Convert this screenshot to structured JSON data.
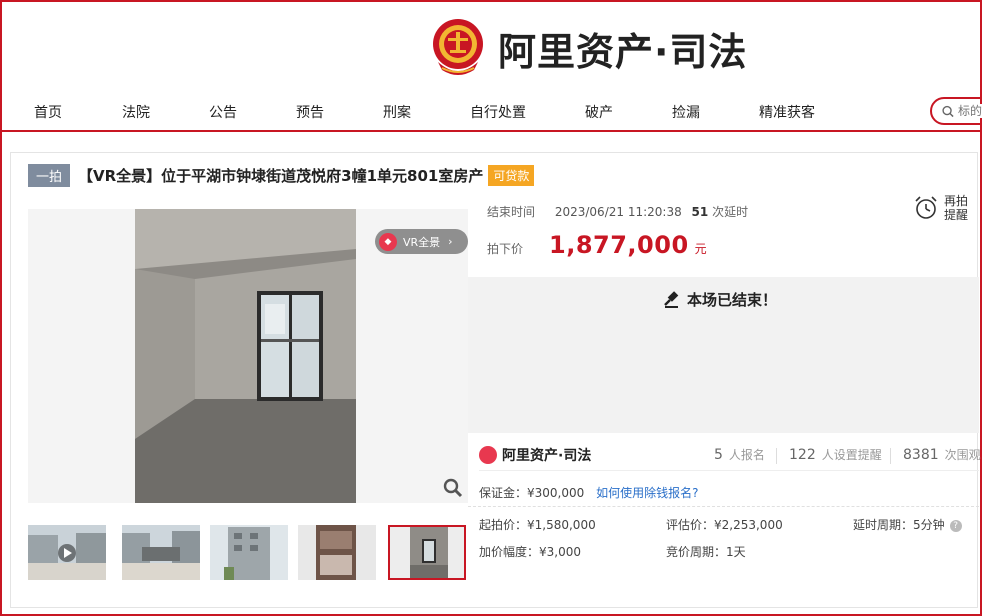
{
  "brand": {
    "name": "阿里资产·司法"
  },
  "nav": {
    "items": [
      "首页",
      "法院",
      "公告",
      "预告",
      "刑案",
      "自行处置",
      "破产",
      "捡漏",
      "精准获客"
    ],
    "search_placeholder": "标的"
  },
  "lot": {
    "badge": "一拍",
    "title": "【VR全景】位于平湖市钟埭街道茂悦府3幢1单元801室房产",
    "loan_tag": "可贷款",
    "vr_label": "VR全景"
  },
  "auction": {
    "end_label": "结束时间",
    "end_time": "2023/06/21 11:20:38",
    "delay_count": "51",
    "delay_label": "次延时",
    "remind_label": "再拍提醒",
    "price_label": "拍下价",
    "price": "1,877,000",
    "price_unit": "元",
    "ended_text": "本场已结束！"
  },
  "stats": {
    "brand": "阿里资产·司法",
    "signups": "5",
    "signups_label": "人报名",
    "reminders": "122",
    "reminders_label": "人设置提醒",
    "views": "8381",
    "views_label": "次围观"
  },
  "details": {
    "deposit": "保证金：¥300,000",
    "deposit_link": "如何使用除钱报名?",
    "start_price": "起拍价：¥1,580,000",
    "appraisal": "评估价：¥2,253,000",
    "delay_period": "延时周期：5分钟",
    "increment": "加价幅度：¥3,000",
    "bid_period": "竞价周期：1天"
  },
  "colors": {
    "brand_red": "#c81623",
    "price_red": "#c81623",
    "loan_orange": "#f5a623",
    "badge_gray": "#7f8c9e",
    "link_blue": "#2a6fc9"
  }
}
